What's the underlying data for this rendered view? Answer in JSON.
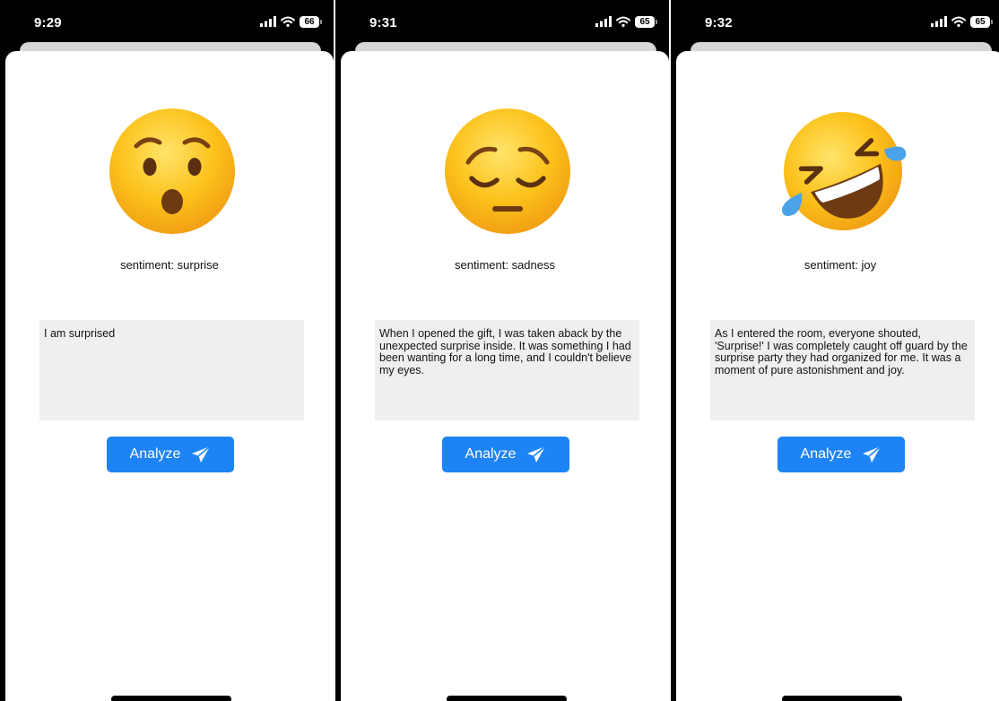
{
  "screens": [
    {
      "status": {
        "time": "9:29",
        "battery": "66"
      },
      "emoji": "surprise-face",
      "sentiment_label": "sentiment: surprise",
      "input_text": "I am surprised",
      "analyze_label": "Analyze"
    },
    {
      "status": {
        "time": "9:31",
        "battery": "65"
      },
      "emoji": "pensive-face",
      "sentiment_label": "sentiment: sadness",
      "input_text": "When I opened the gift, I was taken aback by the unexpected surprise inside. It was something I had been wanting for a long time, and I couldn't believe my eyes.",
      "analyze_label": "Analyze"
    },
    {
      "status": {
        "time": "9:32",
        "battery": "65"
      },
      "emoji": "rolling-on-floor-laughing-face",
      "sentiment_label": "sentiment: joy",
      "input_text": "As I entered the room, everyone shouted, 'Surprise!' I was completely caught off guard by the surprise party they had organized for me. It was a moment of pure astonishment and joy.",
      "analyze_label": "Analyze"
    }
  ],
  "colors": {
    "button": "#1e84f5",
    "text_area": "#efefef",
    "emoji_yellow": "#fcc21b"
  }
}
